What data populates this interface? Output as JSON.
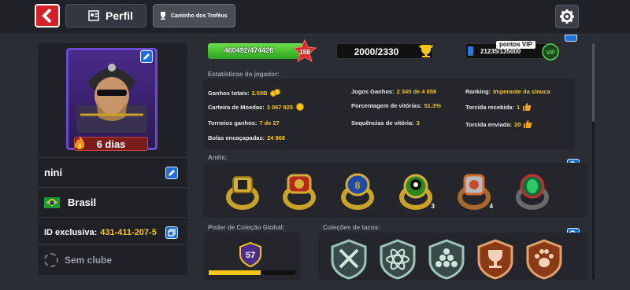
{
  "header": {
    "perfil_label": "Perfil",
    "trofeus_label": "Caminho dos Troféus"
  },
  "profile": {
    "streak": "6 dias",
    "username": "nini",
    "country": "Brasil",
    "id_label": "ID exclusiva:",
    "id_value": "431-411-207-5",
    "club": "Sem clube"
  },
  "bars": {
    "xp_text": "460492/474426",
    "xp_fraction": 0.97,
    "level": "158",
    "trophies": "2000/2330",
    "vip_text": "21235/135000",
    "vip_fraction": 0.06,
    "vip_tag": "pontos VIP"
  },
  "stats": {
    "title": "Estatísticas do jogador:",
    "ganhos_label": "Ganhos totais:",
    "ganhos_value": "2.50B",
    "carteira_label": "Carteira de Moedas:",
    "carteira_value": "3 067 925",
    "torneios_label": "Torneios ganhos:",
    "torneios_value": "7 de 27",
    "bolas_label": "Bolas encaçapadas:",
    "bolas_value": "24 968",
    "jogos_label": "Jogos Ganhos:",
    "jogos_value": "2 340 de 4 559",
    "porcentagem_label": "Porcentagem de vitórias:",
    "porcentagem_value": "51.3%",
    "sequencias_label": "Sequências de vitória:",
    "sequencias_value": "3",
    "ranking_label": "Ranking:",
    "ranking_value": "Imperante da sinuca",
    "torcida_recebida_label": "Torcida recebida:",
    "torcida_recebida_value": "1",
    "torcida_enviada_label": "Torcida enviada:",
    "torcida_enviada_value": "20"
  },
  "rings": {
    "title": "Anéis:",
    "counts": [
      "",
      "",
      "",
      "3",
      "4",
      ""
    ]
  },
  "power": {
    "title": "Poder de Coleção Global:",
    "value": "57",
    "fraction": 0.6
  },
  "cues": {
    "title": "Coleções de tacos:"
  },
  "colors": {
    "accent_blue": "#1e70d8",
    "gold": "#f5c518",
    "back_red": "#d42027"
  }
}
